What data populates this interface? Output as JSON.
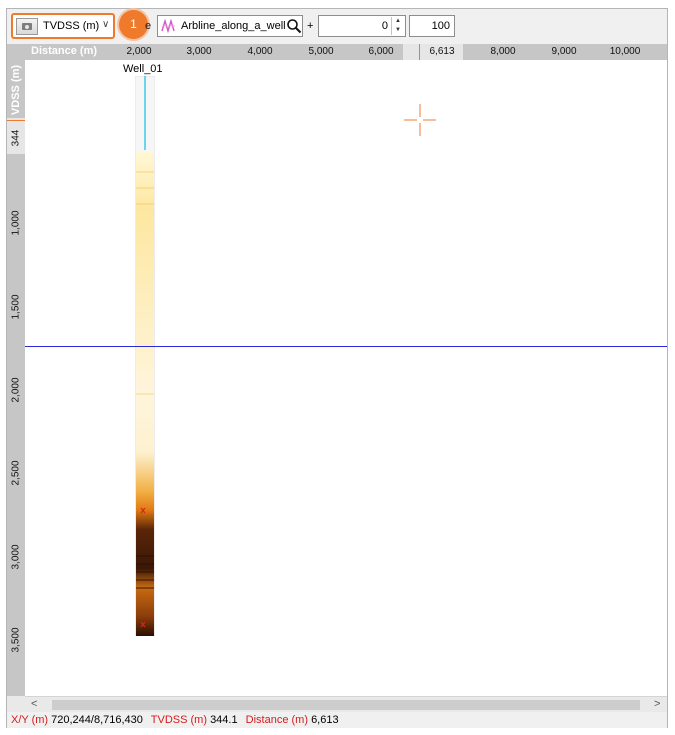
{
  "toolbar": {
    "domain_label": "TVDSS (m)",
    "step_badge": "1",
    "fragment": "e",
    "line_name": "Arbline_along_a_well",
    "plus": "+",
    "offset_value": "0",
    "second_value": "100",
    "icons": [
      "camera-icon",
      "chevron-down-icon",
      "arbitrary-line-icon",
      "magnifier-icon",
      "spin-up-icon",
      "spin-down-icon"
    ]
  },
  "ruler_h": {
    "title": "Distance (m)",
    "ticks": [
      "2,000",
      "3,000",
      "4,000",
      "5,000",
      "6,000",
      "6,613",
      "8,000",
      "9,000",
      "10,000"
    ],
    "current": "6,613"
  },
  "ruler_v": {
    "title": "VDSS (m)",
    "ticks": [
      "344",
      "1,000",
      "1,500",
      "2,000",
      "2,500",
      "3,000",
      "3,500"
    ],
    "current": "344"
  },
  "plot": {
    "well_name": "Well_01",
    "horizon_color": "#2a2ad8",
    "cursor_color": "#f07a2c",
    "well_track_color": "#2ec5e8"
  },
  "scrollbar": {
    "left_arrow": "<",
    "right_arrow": ">"
  },
  "status": {
    "xy_label": "X/Y (m)",
    "xy_value": "720,244/8,716,430",
    "tvdss_label": "TVDSS (m)",
    "tvdss_value": "344.1",
    "distance_label": "Distance (m)",
    "distance_value": "6,613"
  }
}
